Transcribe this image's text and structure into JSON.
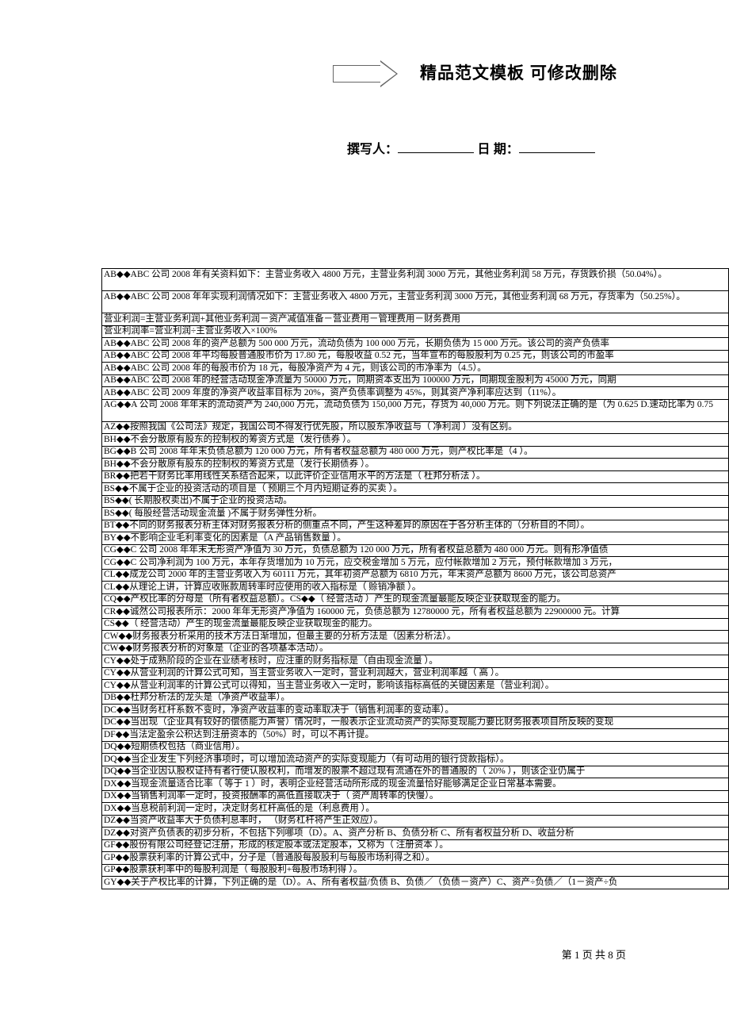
{
  "header": {
    "title": "精品范文模板  可修改删除",
    "author_label": "撰写人：",
    "date_label": "日  期："
  },
  "rows": [
    {
      "text": "AB◆◆ABC 公司 2008 年有关资料如下：主营业务收入 4800 万元，主营业务利润 3000 万元，其他业务利润 58 万元，存货跌价损（50.04%）。",
      "tall": true
    },
    {
      "text": "AB◆◆ABC 公司 2008 年年实现利润情况如下：主营业务收入 4800 万元，主营业务利润 3000 万元，其他业务利润 68 万元，存货率为（50.25%）。",
      "tall": true
    },
    {
      "text": "营业利润=主营业务利润+其他业务利润－资产减值准备－营业费用－管理费用－财务费用"
    },
    {
      "text": "营业利润率=营业利润÷主营业务收入×100%"
    },
    {
      "text": "AB◆◆ABC 公司 2008 年的资产总额为 500 000 万元，流动负债为 100 000 万元，长期负债为 15 000 万元。该公司的资产负债率"
    },
    {
      "text": "AB◆◆ABC 公司 2008 年平均每股普通股市价为 17.80 元，每股收益 0.52 元，当年宣布的每股股利为 0.25 元，则该公司的市盈率"
    },
    {
      "text": "AB◆◆ABC 公司 2008 年的每股市价为 18 元，每股净资产为 4 元，则该公司的市净率为（4.5）。"
    },
    {
      "text": "AB◆◆ABC 公司 2008 年的经营活动现金净流量为 50000 万元，同期资本支出为 100000 万元，同期现金股利为 45000 万元，同期"
    },
    {
      "text": "AB◆◆ABC 公司 2009 年度的净资产收益率目标为 20%，资产负债率调整为 45%，则其资产净利率应达到（11%）。"
    },
    {
      "text": "AG◆◆A 公司 2008 年年末的流动资产为 240,000 万元，流动负债为 150,000 万元，存货为 40,000 万元。则下列说法正确的是（为 0.625 D.速动比率为 0.75",
      "tall": true
    },
    {
      "text": "AZ◆◆按照我国《公司法》规定，我国公司不得发行优先股，所以股东净收益与（    净利润      ）没有区别。"
    },
    {
      "text": "BH◆◆不会分散原有股东的控制权的筹资方式是（发行债券    ）。"
    },
    {
      "text": "BG◆◆B 公司 2008 年年末负债总额为 120 000 万元，所有者权益总额为 480 000 万元，则产权比率是（4 ）。"
    },
    {
      "text": "BH◆◆不会分散原有股东的控制权的筹资方式是（发行长期债券    ）。"
    },
    {
      "text": "BR◆◆把若干财务比率用线性关系结合起来，以此评价企业信用水平的方法是（  杜邦分析法  ）。"
    },
    {
      "text": "BS◆◆不属于企业的投资活动的项目是（ 预期三个月内短期证券的买卖 ）。"
    },
    {
      "text": "BS◆◆(     长期股权卖出)不属于企业的投资活动。"
    },
    {
      "text": "BS◆◆( 每股经营活动现金流量      )不属于财务弹性分析。"
    },
    {
      "text": "BT◆◆不同的财务报表分析主体对财务报表分析的侧重点不同，产生这种差异的原因在于各分析主体的（分析目的不同）。"
    },
    {
      "text": "BY◆◆不影响企业毛利率变化的因素是（A 产品销售数量    ）。"
    },
    {
      "text": "CG◆◆C 公司 2008 年年末无形资产净值为 30 万元，负债总额为 120 000 万元，所有者权益总额为 480 000 万元。则有形净值债"
    },
    {
      "text": "CG◆◆C 公司净利润为 100 万元，本年存货增加为 10 万元，应交税金增加 5 万元，应付帐款增加 2 万元，预付帐款增加 3 万元，"
    },
    {
      "text": "CL◆◆成龙公司 2000 年的主营业务收入为 60111 万元，其年初资产总额为 6810 万元，年末资产总额为 8600 万元，该公司总资产"
    },
    {
      "text": "CL◆◆从理论上讲，计算应收账款周转率时应使用的收入指标是（ 赊销净额  ）。"
    },
    {
      "text": "CQ◆◆产权比率的分母是（所有者权益总额）。CS◆◆（    经营活动    ）产生的现金流量最能反映企业获取现金的能力。"
    },
    {
      "text": "CR◆◆诚然公司报表所示：2000 年年无形资产净值为 160000 元，负债总额为 12780000 元，所有者权益总额为 22900000 元。计算"
    },
    {
      "text": "CS◆◆（ 经营活动）产生的现金流量最能反映企业获取现金的能力。"
    },
    {
      "text": "CW◆◆财务报表分析采用的技术方法日渐增加，但最主要的分析方法是（因素分析法）。"
    },
    {
      "text": "CW◆◆财务报表分析的对象是（企业的各项基本活动）。"
    },
    {
      "text": "CY◆◆处于成熟阶段的企业在业绩考核时，应注重的财务指标是（自由现金流量    ）。"
    },
    {
      "text": "CY◆◆从营业利润的计算公式可知，当主营业务收入一定时，营业利润越大，营业利润率越（ 高 ）。"
    },
    {
      "text": "CY◆◆从营业利润率的计算公式可以得知，当主营业务收入一定时，影响该指标高低的关键因素是（营业利润）。"
    },
    {
      "text": "DB◆◆杜邦分析法的龙头是（净资产收益率）。"
    },
    {
      "text": "DC◆◆当财务杠杆系数不变时，净资产收益率的变动率取决于（销售利润率的变动率）。"
    },
    {
      "text": "DC◆◆当出现（企业具有较好的偿债能力声誉）情况时，一般表示企业流动资产的实际变现能力要比财务报表项目所反映的变现"
    },
    {
      "text": "DF◆◆当法定盈余公积达到注册资本的（50%）时，可以不再计提。"
    },
    {
      "text": "DQ◆◆短期债权包括（商业信用）。"
    },
    {
      "text": "DQ◆◆当企业发生下列经济事项时，可以增加流动资产的实际变现能力（有可动用的银行贷款指标）。"
    },
    {
      "text": "DQ◆◆当企业因认股权证持有者行使认股权利，而增发的股票不超过现有流通在外的普通股的（     20%     ），则该企业仍属于"
    },
    {
      "text": "DX◆◆当现金流量适合比率（ 等于 1       ）时，表明企业经营活动所形成的现金流量恰好能够满足企业日常基本需要。"
    },
    {
      "text": "DX◆◆当销售利润率一定时，投资报酬率的高低直接取决于（ 资产周转率的快慢）。"
    },
    {
      "text": "DX◆◆当息税前利润一定时，决定财务杠杆高低的是（利息费用  ）。"
    },
    {
      "text": "DZ◆◆当资产收益率大于负债利息率时，  （财务杠杆将产生正效应）。"
    },
    {
      "text": "DZ◆◆对资产负债表的初步分析，不包括下列哪项（D）。A、资产分析 B、负债分析 C、所有者权益分析 D、收益分析"
    },
    {
      "text": "GF◆◆股份有限公司经登记注册，形成的核定股本或法定股本，又称为（ 注册资本    ）。"
    },
    {
      "text": "GP◆◆股票获利率的计算公式中，分子是（普通股每股股利与每股市场利得之和）。"
    },
    {
      "text": "GP◆◆股票获利率中的每股利润是（ 每股股利+每股市场利得    ）。"
    },
    {
      "text": "GY◆◆关于产权比率的计算，下列正确的是（D）。A、所有者权益/负债 B、负债／（负债－资产）C、资产÷负债／（1－资产÷负"
    }
  ],
  "footer": {
    "page_label": "第 1 页 共 8 页"
  }
}
